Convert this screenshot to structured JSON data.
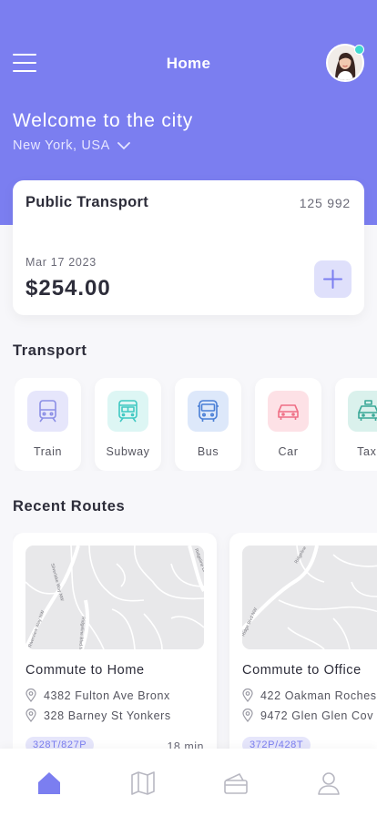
{
  "header": {
    "title": "Home",
    "menu_icon": "hamburger-menu-icon",
    "welcome": "Welcome to the city",
    "location": "New York, USA",
    "online_status_color": "#3fd8d0",
    "accent": "#7b7ef0"
  },
  "balance_card": {
    "title": "Public Transport",
    "card_number": "125 992",
    "date": "Mar 17 2023",
    "amount": "$254.00",
    "add_icon": "plus-icon"
  },
  "transport": {
    "heading": "Transport",
    "items": [
      {
        "label": "Train",
        "icon": "train-icon",
        "color": "#8b8fe6",
        "bg": "#e6e6fb"
      },
      {
        "label": "Subway",
        "icon": "subway-icon",
        "color": "#3fc8c2",
        "bg": "#ddf6f4"
      },
      {
        "label": "Bus",
        "icon": "bus-icon",
        "color": "#4a7fd6",
        "bg": "#dde8fa"
      },
      {
        "label": "Car",
        "icon": "car-icon",
        "color": "#ef6f85",
        "bg": "#fde1e6"
      },
      {
        "label": "Taxi",
        "icon": "taxi-icon",
        "color": "#3aa897",
        "bg": "#daf1ec"
      }
    ]
  },
  "routes": {
    "heading": "Recent Routes",
    "items": [
      {
        "title": "Commute to Home",
        "from": "4382 Fulton Ave Bronx",
        "to": "328 Barney St Yonkers",
        "lines": "328T/827P",
        "duration": "18 min",
        "map_labels": [
          "Silverlake Way NW",
          "Ridgeline Blvd NW",
          "Ridgeline Dr NW",
          "Riverview Way NW"
        ]
      },
      {
        "title": "Commute to Office",
        "from": "422 Oakman Roches",
        "to": "9472 Glen Glen Cov",
        "lines": "372P/428T",
        "duration": "",
        "map_labels": [
          "Ridgeline",
          "Ridge Blvd NW"
        ]
      }
    ]
  },
  "bottom_nav": {
    "items": [
      {
        "icon": "home-icon",
        "active": true
      },
      {
        "icon": "map-icon",
        "active": false
      },
      {
        "icon": "wallet-icon",
        "active": false
      },
      {
        "icon": "profile-icon",
        "active": false
      }
    ],
    "active_color": "#7b7ef0",
    "inactive_color": "#b8b8c2"
  }
}
